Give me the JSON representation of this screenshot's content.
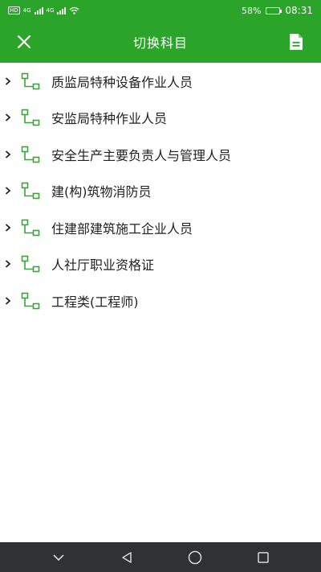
{
  "status_bar": {
    "badges": [
      "HD",
      "4G",
      "4G"
    ],
    "battery": "58%",
    "battery_level": 0.58,
    "time": "08:31"
  },
  "app_bar": {
    "title": "切换科目",
    "close_icon": "close-icon",
    "action_icon": "document-icon"
  },
  "categories": [
    {
      "label": "质监局特种设备作业人员"
    },
    {
      "label": "安监局特种作业人员"
    },
    {
      "label": "安全生产主要负责人与管理人员"
    },
    {
      "label": "建(构)筑物消防员"
    },
    {
      "label": "住建部建筑施工企业人员"
    },
    {
      "label": "人社厅职业资格证"
    },
    {
      "label": "工程类(工程师)"
    }
  ],
  "colors": {
    "brand_green": "#2aa52a",
    "tree_icon_green": "#3aa53a",
    "nav_bar": "#2f3135"
  },
  "nav_bar": {
    "buttons": [
      "chevron-down-icon",
      "back-triangle-icon",
      "home-circle-icon",
      "recents-square-icon"
    ]
  }
}
